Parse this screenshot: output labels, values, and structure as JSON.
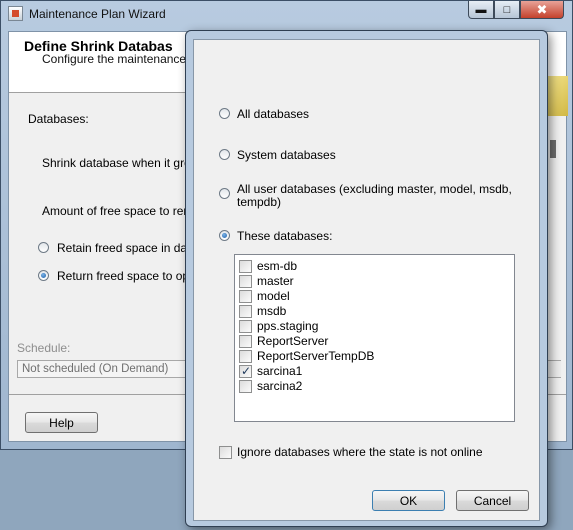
{
  "wizard": {
    "title": "Maintenance Plan Wizard",
    "header_title": "Define Shrink Databas",
    "header_subtitle": "Configure the maintenance tas",
    "databases_label": "Databases:",
    "shrink_label": "Shrink database when it grows",
    "free_space_label": "Amount of free space to remai",
    "retain_label": "Retain freed space in datab",
    "return_label": "Return freed space to opera",
    "schedule_label": "Schedule:",
    "schedule_value": "Not scheduled (On Demand)",
    "help_button": "Help",
    "min_icon": "minimize-icon",
    "max_icon": "maximize-icon",
    "close_icon": "close-icon"
  },
  "dialog": {
    "all_databases": "All databases",
    "system_databases": "System databases",
    "all_user_databases_line1": "All user databases  (excluding master, model, msdb,",
    "all_user_databases_line2": "tempdb)",
    "these_databases": "These databases:",
    "selected_option": "these_databases",
    "databases": [
      {
        "name": "esm-db",
        "checked": false
      },
      {
        "name": "master",
        "checked": false
      },
      {
        "name": "model",
        "checked": false
      },
      {
        "name": "msdb",
        "checked": false
      },
      {
        "name": "pps.staging",
        "checked": false
      },
      {
        "name": "ReportServer",
        "checked": false
      },
      {
        "name": "ReportServerTempDB",
        "checked": false
      },
      {
        "name": "sarcina1",
        "checked": true
      },
      {
        "name": "sarcina2",
        "checked": false
      }
    ],
    "ignore_offline_label": "Ignore databases where the state is not online",
    "ignore_offline_checked": false,
    "ok_button": "OK",
    "cancel_button": "Cancel"
  }
}
